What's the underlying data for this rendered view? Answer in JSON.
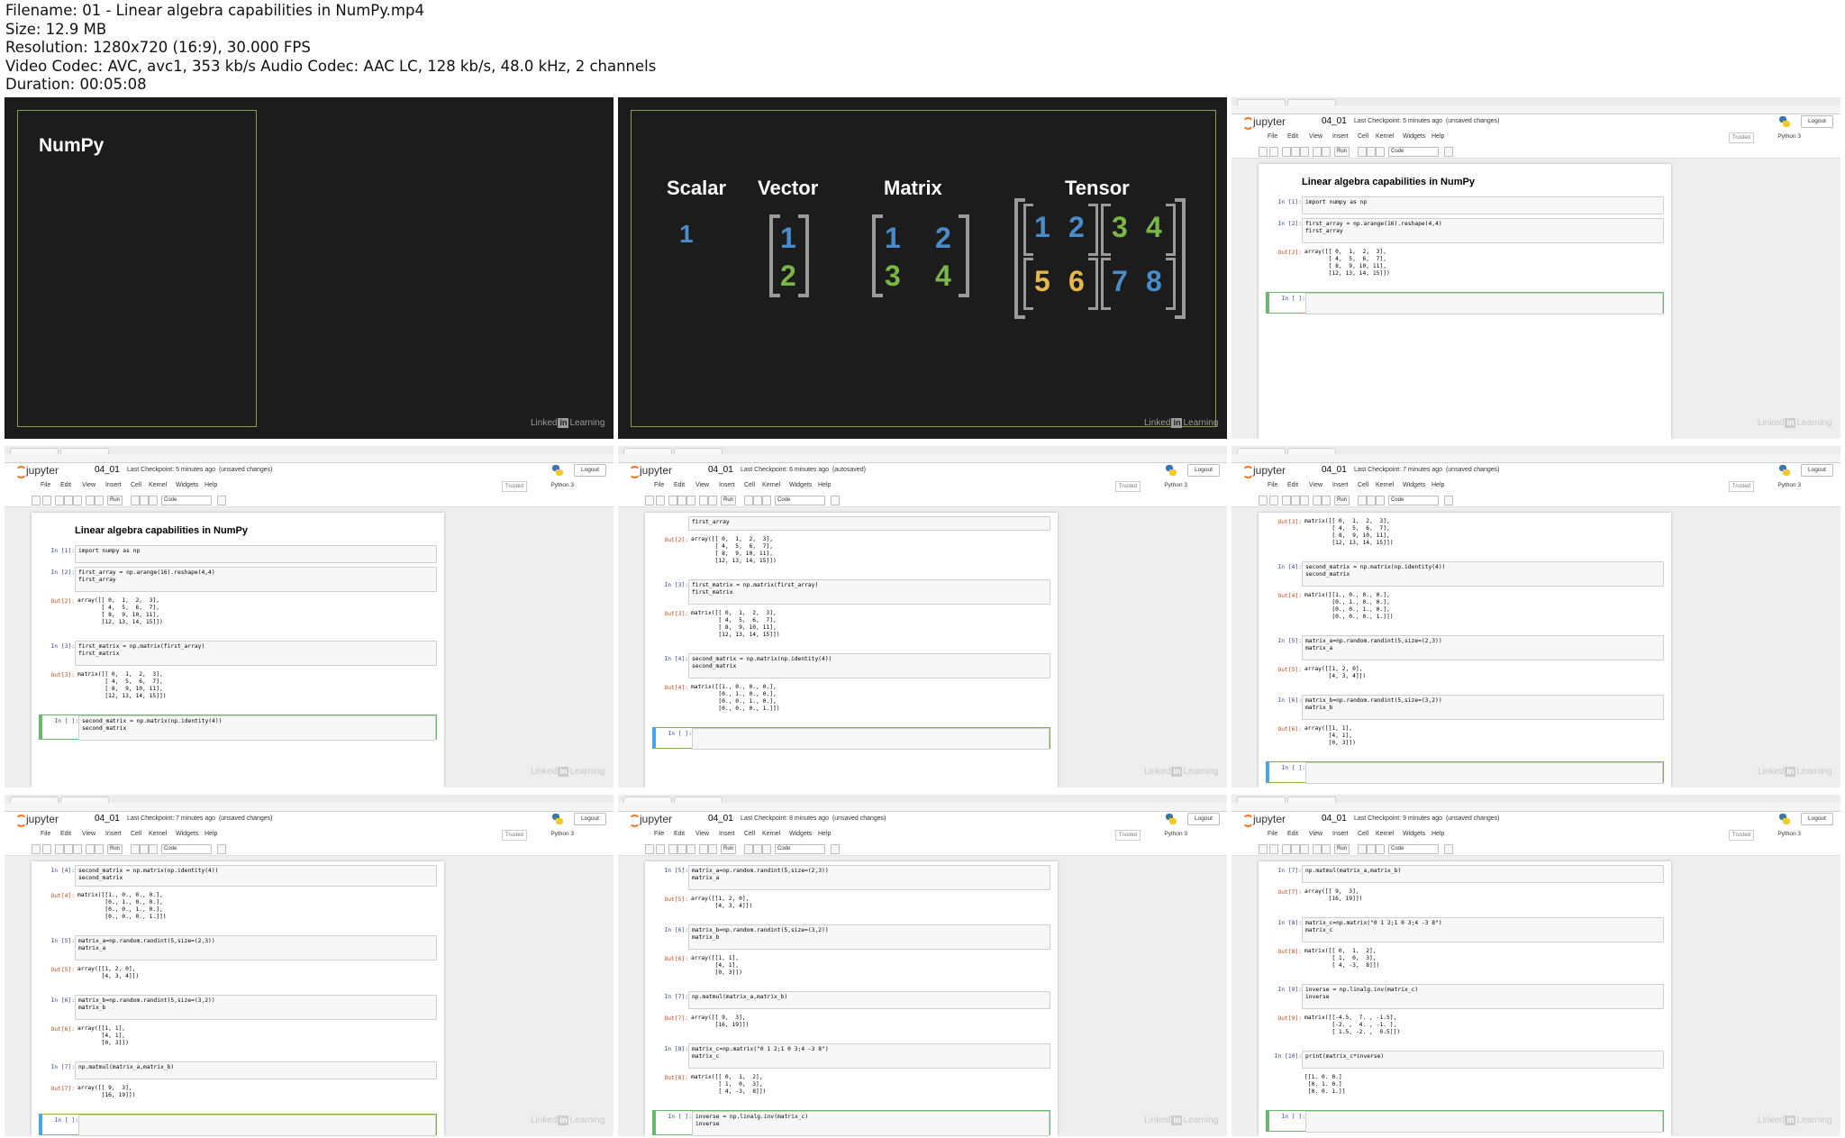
{
  "header": {
    "filename": "Filename: 01 - Linear algebra capabilities in NumPy.mp4",
    "size": "Size: 12.9 MB",
    "resolution": "Resolution: 1280x720 (16:9), 30.000 FPS",
    "codec": "Video Codec: AVC, avc1, 353 kb/s Audio Codec: AAC LC, 128 kb/s, 48.0 kHz, 2 channels",
    "duration": "Duration: 00:05:08"
  },
  "linkedin": {
    "text1": "Linked",
    "box": "in",
    "text2": "Learning"
  },
  "slide1": {
    "title": "NumPy"
  },
  "slide2": {
    "scalar": "Scalar",
    "vector": "Vector",
    "matrix": "Matrix",
    "tensor": "Tensor",
    "scalar_val": "1",
    "vector_vals": [
      "1",
      "2"
    ],
    "matrix_vals": [
      "1",
      "2",
      "3",
      "4"
    ],
    "tensor_vals": [
      "1",
      "2",
      "3",
      "4",
      "5",
      "6",
      "7",
      "8"
    ]
  },
  "jupyter": {
    "logo": "jupyter",
    "nb_name": "04_01",
    "logout": "Logout",
    "trusted": "Trusted",
    "kernel": "Python 3",
    "cell_type": "Code",
    "run": "Run",
    "menu": [
      "File",
      "Edit",
      "View",
      "Insert",
      "Cell",
      "Kernel",
      "Widgets",
      "Help"
    ],
    "title": "Linear algebra capabilities in NumPy"
  },
  "frames": [
    {
      "ckpt": "Last Checkpoint: 5 minutes ago",
      "status": "(unsaved changes)"
    },
    {
      "ckpt": "Last Checkpoint: 5 minutes ago",
      "status": "(unsaved changes)"
    },
    {
      "ckpt": "Last Checkpoint: 6 minutes ago",
      "status": "(autosaved)"
    },
    {
      "ckpt": "Last Checkpoint: 7 minutes ago",
      "status": "(unsaved changes)"
    },
    {
      "ckpt": "Last Checkpoint: 7 minutes ago",
      "status": "(unsaved changes)"
    },
    {
      "ckpt": "Last Checkpoint: 8 minutes ago",
      "status": "(unsaved changes)"
    },
    {
      "ckpt": "Last Checkpoint: 9 minutes ago",
      "status": "(unsaved changes)"
    }
  ],
  "cells": {
    "in1": "In [1]:",
    "in2": "In [2]:",
    "out2": "Out[2]:",
    "in3": "In [3]:",
    "out3": "Out[3]:",
    "in4": "In [4]:",
    "out4": "Out[4]:",
    "in5": "In [5]:",
    "out5": "Out[5]:",
    "in6": "In [6]:",
    "out6": "Out[6]:",
    "in7": "In [7]:",
    "out7": "Out[7]:",
    "in8": "In [8]:",
    "out8": "Out[8]:",
    "in9": "In [9]:",
    "out9": "Out[9]:",
    "in10": "In [10]:",
    "in_empty": "In [ ]:",
    "code1": "import numpy as np",
    "code2": "first_array = np.arange(16).reshape(4,4)\nfirst_array",
    "code2b": "first_array",
    "out2_text": "array([[ 0,  1,  2,  3],\n       [ 4,  5,  6,  7],\n       [ 8,  9, 10, 11],\n       [12, 13, 14, 15]])",
    "code3": "first_matrix = np.matrix(first_array)\nfirst_matrix",
    "out3_text": "matrix([[ 0,  1,  2,  3],\n        [ 4,  5,  6,  7],\n        [ 8,  9, 10, 11],\n        [12, 13, 14, 15]])",
    "code4": "second_matrix = np.matrix(np.identity(4))\nsecond_matrix",
    "code4b": "second_matrix = np.matrix(np.identity(4))\nsecond_matrix",
    "out4_text": "matrix([[1., 0., 0., 0.],\n        [0., 1., 0., 0.],\n        [0., 0., 1., 0.],\n        [0., 0., 0., 1.]])",
    "code5": "matrix_a=np.random.randint(5,size=(2,3))\nmatrix_a",
    "out5_text": "array([[1, 2, 0],\n       [4, 3, 4]])",
    "code6": "matrix_b=np.random.randint(5,size=(3,2))\nmatrix_b",
    "out6_text": "array([[1, 1],\n       [4, 1],\n       [0, 3]])",
    "code7": "np.matmul(matrix_a,matrix_b)",
    "out7_text": "array([[ 9,  3],\n       [16, 19]])",
    "code8": "matrix_c=np.matrix(\"0 1 2;1 0 3;4 -3 8\")\nmatrix_c",
    "out8_text": "matrix([[ 0,  1,  2],\n        [ 1,  0,  3],\n        [ 4, -3,  8]])",
    "code9": "inverse = np.linalg.inv(matrix_c)\ninverse",
    "out9_text": "matrix([[-4.5,  7. , -1.5],\n        [-2. ,  4. , -1. ],\n        [ 1.5, -2. ,  0.5]])",
    "code10": "print(matrix_c*inverse)",
    "out10_text": "[[1. 0. 0.]\n [0. 1. 0.]\n [0. 0. 1.]]"
  }
}
